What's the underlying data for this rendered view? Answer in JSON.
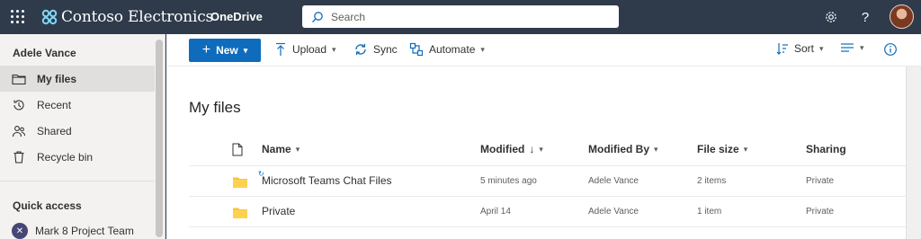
{
  "header": {
    "brand": "Contoso Electronics",
    "app": "OneDrive",
    "search_placeholder": "Search",
    "help_label": "?"
  },
  "sidebar": {
    "user": "Adele Vance",
    "items": [
      {
        "label": "My files",
        "icon": "folder-icon",
        "active": true
      },
      {
        "label": "Recent",
        "icon": "history-icon",
        "active": false
      },
      {
        "label": "Shared",
        "icon": "people-icon",
        "active": false
      },
      {
        "label": "Recycle bin",
        "icon": "trash-icon",
        "active": false
      }
    ],
    "quick_access_title": "Quick access",
    "quick_access": [
      {
        "label": "Mark 8 Project Team"
      }
    ]
  },
  "toolbar": {
    "new_label": "New",
    "upload_label": "Upload",
    "sync_label": "Sync",
    "automate_label": "Automate",
    "sort_label": "Sort"
  },
  "main": {
    "title": "My files",
    "columns": [
      "Name",
      "Modified",
      "Modified By",
      "File size",
      "Sharing"
    ],
    "rows": [
      {
        "name": "Microsoft Teams Chat Files",
        "modified": "5 minutes ago",
        "modified_by": "Adele Vance",
        "size": "2 items",
        "sharing": "Private"
      },
      {
        "name": "Private",
        "modified": "April 14",
        "modified_by": "Adele Vance",
        "size": "1 item",
        "sharing": "Private"
      }
    ]
  },
  "colors": {
    "suite_header": "#2f3b4b",
    "primary": "#0f6cbd",
    "folder": "#f4c542",
    "nav_bg": "#f3f2f1"
  }
}
